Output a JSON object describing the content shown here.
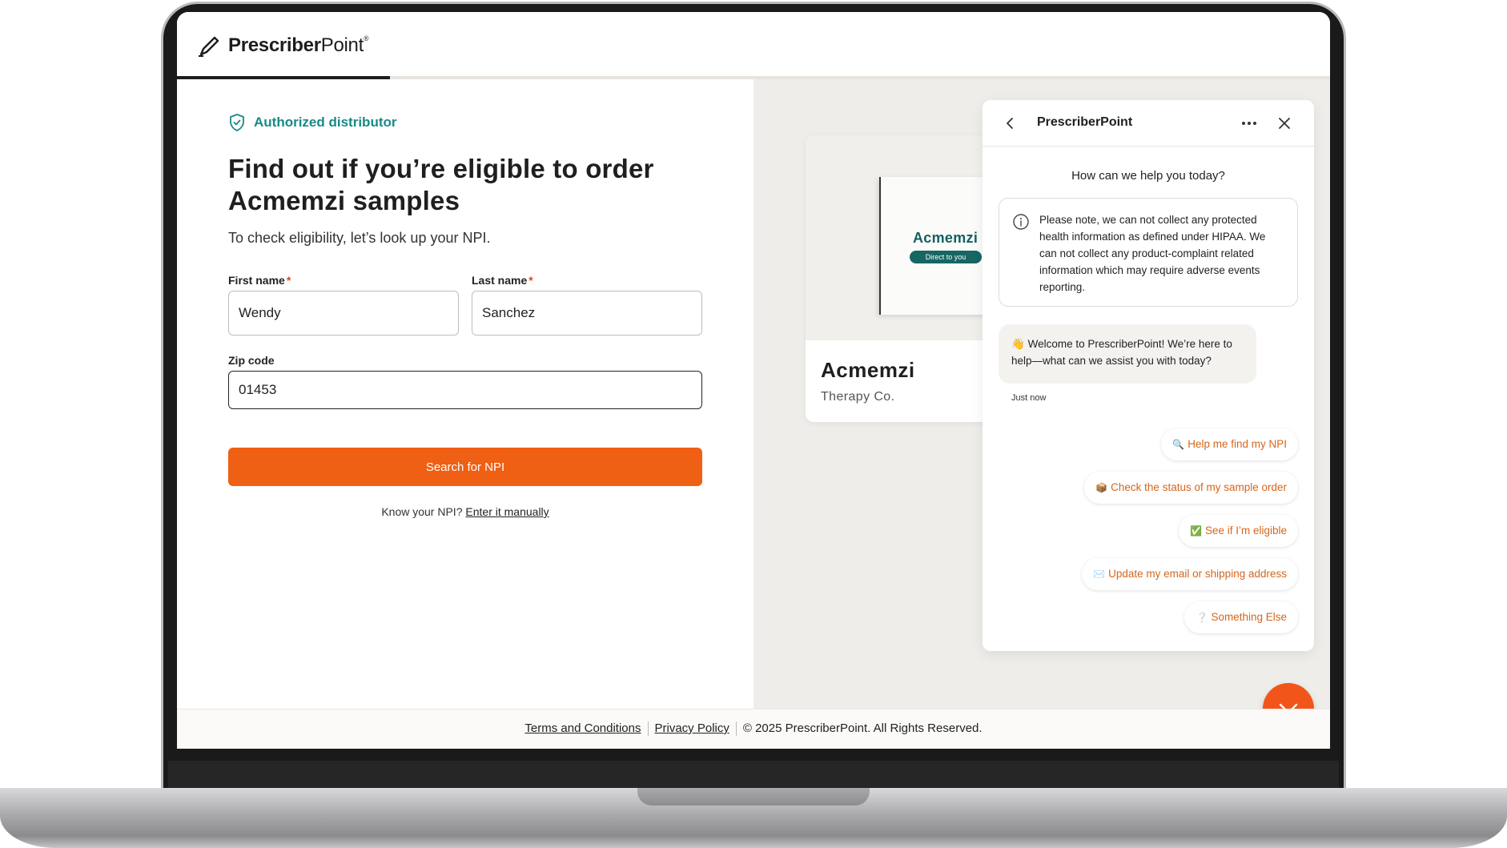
{
  "brand": {
    "name_bold": "Prescriber",
    "name_light": "Point",
    "registered": "®"
  },
  "progress": {
    "fraction": 0.185
  },
  "form": {
    "badge": "Authorized distributor",
    "heading": "Find out if you’re eligible to order Acmemzi samples",
    "subtext": "To check eligibility, let’s look up your NPI.",
    "first_name": {
      "label": "First name",
      "required_mark": "*",
      "value": "Wendy"
    },
    "last_name": {
      "label": "Last name",
      "required_mark": "*",
      "value": "Sanchez"
    },
    "zip": {
      "label": "Zip code",
      "value": "01453"
    },
    "search_button": "Search for NPI",
    "npi_hint": "Know your NPI?",
    "npi_link": "Enter it manually"
  },
  "product": {
    "box_brand": "Acmemzi",
    "box_tag": "Direct to you",
    "name": "Acmemzi",
    "company": "Therapy Co."
  },
  "chat": {
    "title": "PrescriberPoint",
    "prompt": "How can we help you today?",
    "notice": "Please note, we can not collect any protected health information as defined under HIPAA. We can not collect any product-complaint related information which may require adverse events reporting.",
    "welcome_emoji": "👋",
    "welcome": "Welcome to PrescriberPoint! We’re here to help—what can we assist you with today?",
    "time": "Just now",
    "quick_replies": [
      {
        "emoji": "🔍",
        "label": "Help me find my NPI"
      },
      {
        "emoji": "📦",
        "label": "Check the status of my sample order"
      },
      {
        "emoji": "✅",
        "label": "See if I’m eligible"
      },
      {
        "emoji": "✉️",
        "label": "Update my email or shipping address"
      },
      {
        "emoji": "❔",
        "label": "Something Else"
      }
    ]
  },
  "footer": {
    "terms": "Terms and Conditions",
    "privacy": "Privacy Policy",
    "copyright": "© 2025 PrescriberPoint. All Rights Reserved."
  },
  "colors": {
    "accent_orange": "#ef5f14",
    "teal": "#178a86",
    "quick_reply_text": "#d4661c"
  },
  "icons": [
    "pen-logo-icon",
    "shield-check-icon",
    "chevron-left-icon",
    "more-icon",
    "close-icon",
    "info-icon",
    "chevron-down-icon"
  ]
}
